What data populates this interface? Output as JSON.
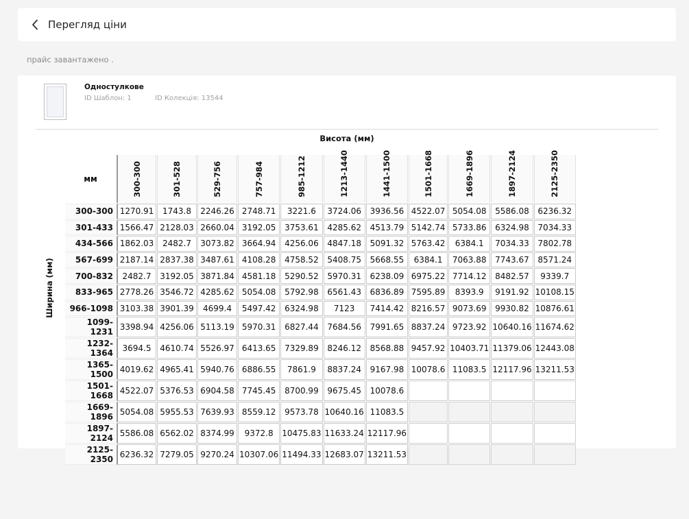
{
  "header": {
    "title": "Перегляд ціни",
    "back_icon": "chevron-left-icon"
  },
  "status_text": "прайс завантажено .",
  "template": {
    "name": "Одностулкове",
    "template_id_text": "ID Шаблон: 1",
    "collection_id_text": "ID Колекція: 13544"
  },
  "table": {
    "height_axis_label": "Висота (мм)",
    "width_axis_label": "Ширина (мм)",
    "corner_label": "мм",
    "columns": [
      "300-300",
      "301-528",
      "529-756",
      "757-984",
      "985-1212",
      "1213-1440",
      "1441-1500",
      "1501-1668",
      "1669-1896",
      "1897-2124",
      "2125-2350"
    ],
    "rows": [
      {
        "label": "300-300",
        "cells": [
          "1270.91",
          "1743.8",
          "2246.26",
          "2748.71",
          "3221.6",
          "3724.06",
          "3936.56",
          "4522.07",
          "5054.08",
          "5586.08",
          "6236.32"
        ]
      },
      {
        "label": "301-433",
        "cells": [
          "1566.47",
          "2128.03",
          "2660.04",
          "3192.05",
          "3753.61",
          "4285.62",
          "4513.79",
          "5142.74",
          "5733.86",
          "6324.98",
          "7034.33"
        ]
      },
      {
        "label": "434-566",
        "cells": [
          "1862.03",
          "2482.7",
          "3073.82",
          "3664.94",
          "4256.06",
          "4847.18",
          "5091.32",
          "5763.42",
          "6384.1",
          "7034.33",
          "7802.78"
        ]
      },
      {
        "label": "567-699",
        "cells": [
          "2187.14",
          "2837.38",
          "3487.61",
          "4108.28",
          "4758.52",
          "5408.75",
          "5668.55",
          "6384.1",
          "7063.88",
          "7743.67",
          "8571.24"
        ]
      },
      {
        "label": "700-832",
        "cells": [
          "2482.7",
          "3192.05",
          "3871.84",
          "4581.18",
          "5290.52",
          "5970.31",
          "6238.09",
          "6975.22",
          "7714.12",
          "8482.57",
          "9339.7"
        ]
      },
      {
        "label": "833-965",
        "cells": [
          "2778.26",
          "3546.72",
          "4285.62",
          "5054.08",
          "5792.98",
          "6561.43",
          "6836.89",
          "7595.89",
          "8393.9",
          "9191.92",
          "10108.15"
        ]
      },
      {
        "label": "966-1098",
        "cells": [
          "3103.38",
          "3901.39",
          "4699.4",
          "5497.42",
          "6324.98",
          "7123",
          "7414.42",
          "8216.57",
          "9073.69",
          "9930.82",
          "10876.61"
        ]
      },
      {
        "label": "1099-1231",
        "cells": [
          "3398.94",
          "4256.06",
          "5113.19",
          "5970.31",
          "6827.44",
          "7684.56",
          "7991.65",
          "8837.24",
          "9723.92",
          "10640.16",
          "11674.62"
        ]
      },
      {
        "label": "1232-1364",
        "cells": [
          "3694.5",
          "4610.74",
          "5526.97",
          "6413.65",
          "7329.89",
          "8246.12",
          "8568.88",
          "9457.92",
          "10403.71",
          "11379.06",
          "12443.08"
        ]
      },
      {
        "label": "1365-1500",
        "cells": [
          "4019.62",
          "4965.41",
          "5940.76",
          "6886.55",
          "7861.9",
          "8837.24",
          "9167.98",
          "10078.6",
          "11083.5",
          "12117.96",
          "13211.53"
        ]
      },
      {
        "label": "1501-1668",
        "cells": [
          "4522.07",
          "5376.53",
          "6904.58",
          "7745.45",
          "8700.99",
          "9675.45",
          "10078.6",
          "",
          "",
          "",
          ""
        ]
      },
      {
        "label": "1669-1896",
        "cells": [
          "5054.08",
          "5955.53",
          "7639.93",
          "8559.12",
          "9573.78",
          "10640.16",
          "11083.5",
          "",
          "",
          "",
          ""
        ]
      },
      {
        "label": "1897-2124",
        "cells": [
          "5586.08",
          "6562.02",
          "8374.99",
          "9372.8",
          "10475.83",
          "11633.24",
          "12117.96",
          "",
          "",
          "",
          ""
        ]
      },
      {
        "label": "2125-2350",
        "cells": [
          "6236.32",
          "7279.05",
          "9270.24",
          "10307.06",
          "11494.33",
          "12683.07",
          "13211.53",
          "",
          "",
          "",
          ""
        ]
      }
    ]
  }
}
